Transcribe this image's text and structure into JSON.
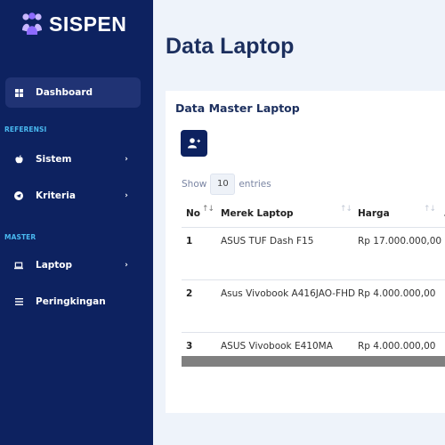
{
  "app": {
    "name": "SISPEN"
  },
  "sidebar": {
    "dashboard": {
      "label": "Dashboard",
      "icon": "grid-icon"
    },
    "sections": [
      {
        "title": "REFERENSI"
      },
      {
        "title": "MASTER"
      }
    ],
    "items": [
      {
        "label": "Sistem",
        "icon": "apple-icon"
      },
      {
        "label": "Kriteria",
        "icon": "send-icon"
      },
      {
        "label": "Laptop",
        "icon": "laptop-icon"
      },
      {
        "label": "Peringkingan",
        "icon": "list-icon"
      }
    ]
  },
  "page": {
    "title": "Data Laptop"
  },
  "card": {
    "title": "Data Master Laptop",
    "add_icon": "user-plus-icon",
    "show_label": "Show",
    "entries_value": "10",
    "entries_label": "entries"
  },
  "table": {
    "columns": [
      "No",
      "Merek Laptop",
      "Harga"
    ],
    "rows": [
      {
        "no": "1",
        "merek": "ASUS TUF Dash F15",
        "harga": "Rp 17.000.000,00"
      },
      {
        "no": "2",
        "merek": "Asus Vivobook A416JAO-FHD",
        "harga": "Rp 4.000.000,00"
      },
      {
        "no": "3",
        "merek": "ASUS Vivobook E410MA",
        "harga": "Rp 4.000.000,00"
      }
    ]
  },
  "colors": {
    "sidebar": "#0d2260",
    "accent": "#49b9f0",
    "active": "#203374"
  }
}
